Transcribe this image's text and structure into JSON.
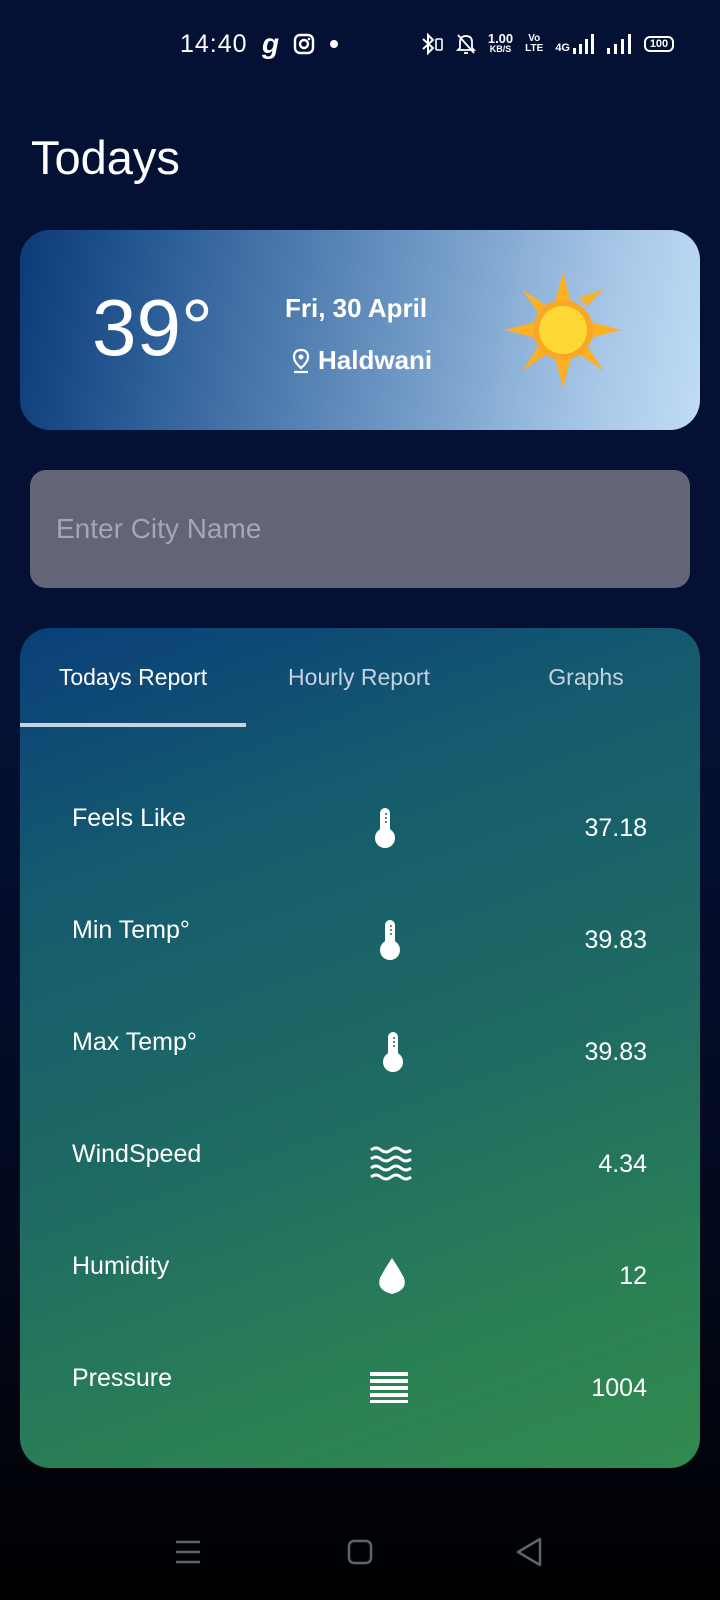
{
  "status_bar": {
    "time": "14:40",
    "speed_value": "1.00",
    "speed_unit": "KB/S",
    "volte_top": "Vo",
    "volte_bottom": "LTE",
    "network": "4G",
    "battery": "100",
    "icons": [
      "g-app-icon",
      "instagram-icon",
      "notification-dot-icon",
      "bluetooth-icon",
      "mute-bell-icon",
      "signal-icon",
      "signal-icon"
    ]
  },
  "page": {
    "title": "Todays"
  },
  "weather_card": {
    "temperature": "39°",
    "date": "Fri, 30 April",
    "location": "Haldwani",
    "icon": "sun-icon"
  },
  "search": {
    "placeholder": "Enter City Name",
    "value": ""
  },
  "tabs": [
    {
      "label": "Todays Report",
      "active": true
    },
    {
      "label": "Hourly Report",
      "active": false
    },
    {
      "label": "Graphs",
      "active": false
    }
  ],
  "report": [
    {
      "label": "Feels Like",
      "icon": "thermometer-icon",
      "value": "37.18"
    },
    {
      "label": "Min Temp°",
      "icon": "thermometer-icon",
      "value": "39.83"
    },
    {
      "label": "Max Temp°",
      "icon": "thermometer-icon",
      "value": "39.83"
    },
    {
      "label": "WindSpeed",
      "icon": "wind-waves-icon",
      "value": "4.34"
    },
    {
      "label": "Humidity",
      "icon": "water-drop-icon",
      "value": "12"
    },
    {
      "label": "Pressure",
      "icon": "pressure-lines-icon",
      "value": "1004"
    }
  ],
  "nav_bar": {
    "icons": [
      "menu-icon",
      "home-icon",
      "back-icon"
    ]
  },
  "colors": {
    "background": "#041135",
    "search_bg": "#636477",
    "sun": "#fbc02d"
  }
}
